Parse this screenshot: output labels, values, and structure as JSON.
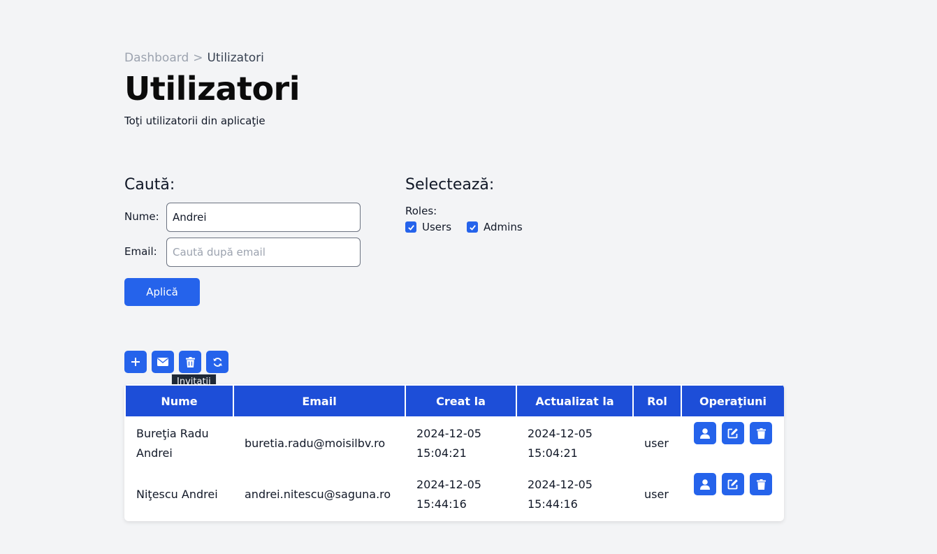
{
  "breadcrumb": {
    "parent": "Dashboard",
    "separator": ">",
    "current": "Utilizatori"
  },
  "page": {
    "title": "Utilizatori",
    "subtitle": "Toţi utilizatorii din aplicaţie"
  },
  "search": {
    "title": "Caută:",
    "name_label": "Nume:",
    "name_value": "Andrei",
    "email_label": "Email:",
    "email_value": "",
    "email_placeholder": "Caută după email",
    "apply_label": "Aplică"
  },
  "select": {
    "title": "Selectează:",
    "roles_label": "Roles:",
    "options": [
      {
        "label": "Users",
        "checked": true
      },
      {
        "label": "Admins",
        "checked": true
      }
    ]
  },
  "toolbar": {
    "icons": [
      "plus-icon",
      "envelope-icon",
      "trash-icon",
      "refresh-icon"
    ],
    "tooltip": "Invitaţii"
  },
  "table": {
    "headers": [
      "Nume",
      "Email",
      "Creat la",
      "Actualizat la",
      "Rol",
      "Operaţiuni"
    ],
    "rows": [
      {
        "name": "Bureţia Radu Andrei",
        "email": "buretia.radu@moisilbv.ro",
        "created": "2024-12-05 15:04:21",
        "updated": "2024-12-05 15:04:21",
        "role": "user"
      },
      {
        "name": "Niţescu Andrei",
        "email": "andrei.nitescu@saguna.ro",
        "created": "2024-12-05 15:44:16",
        "updated": "2024-12-05 15:44:16",
        "role": "user"
      }
    ],
    "row_operation_icons": [
      "user-icon",
      "edit-icon",
      "trash-icon"
    ]
  },
  "colors": {
    "accent": "#2563eb",
    "header_bg": "#1d4ed8",
    "page_bg": "#f3f4f6"
  }
}
